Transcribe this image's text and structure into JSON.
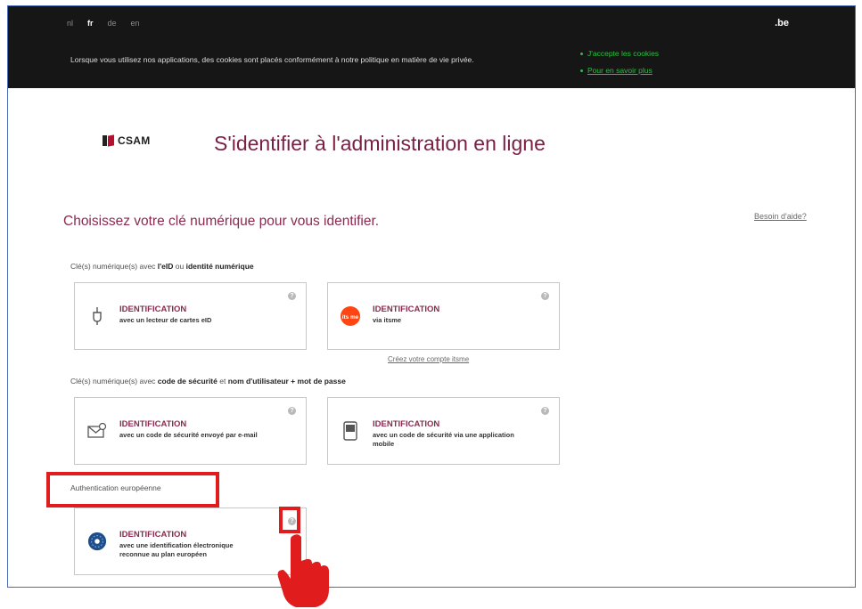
{
  "topbar": {
    "languages": [
      "nl",
      "fr",
      "de",
      "en"
    ],
    "active_language": "fr",
    "brand": ".be",
    "cookie_notice": "Lorsque vous utilisez nos applications, des cookies sont placés conformément à notre politique en matière de vie privée.",
    "accept_cookies": "J'accepte les cookies",
    "learn_more": "Pour en savoir plus"
  },
  "header": {
    "logo_text": "CSAM",
    "title": "S'identifier à l'administration en ligne"
  },
  "main": {
    "choose_heading": "Choisissez votre clé numérique pour vous identifier.",
    "help_link": "Besoin d'aide?",
    "section1": {
      "prefix": "Clé(s) numérique(s) avec ",
      "b1": "l'eID",
      "mid": " ou ",
      "b2": "identité numérique"
    },
    "section2": {
      "prefix": "Clé(s) numérique(s) avec ",
      "b1": "code de sécurité",
      "mid": " et ",
      "b2": "nom d'utilisateur + mot de passe"
    },
    "section3": "Authentication européenne",
    "itsme_link": "Créez votre compte itsme",
    "cards": [
      {
        "title": "IDENTIFICATION",
        "sub": "avec un lecteur de cartes eID",
        "icon": "card-reader-icon"
      },
      {
        "title": "IDENTIFICATION",
        "sub": "via itsme",
        "icon": "itsme-icon"
      },
      {
        "title": "IDENTIFICATION",
        "sub": "avec un code de sécurité envoyé par e-mail",
        "icon": "email-icon"
      },
      {
        "title": "IDENTIFICATION",
        "sub": "avec un code de sécurité via une application mobile",
        "icon": "mobile-app-icon"
      },
      {
        "title": "IDENTIFICATION",
        "sub": "avec une identification électronique reconnue au plan européen",
        "icon": "european-eid-icon"
      }
    ],
    "info_glyph": "?",
    "itsme_badge": "its me"
  },
  "colors": {
    "title": "#7a1f44",
    "highlight": "#e01c1c",
    "cookie_link": "#27c33a"
  }
}
